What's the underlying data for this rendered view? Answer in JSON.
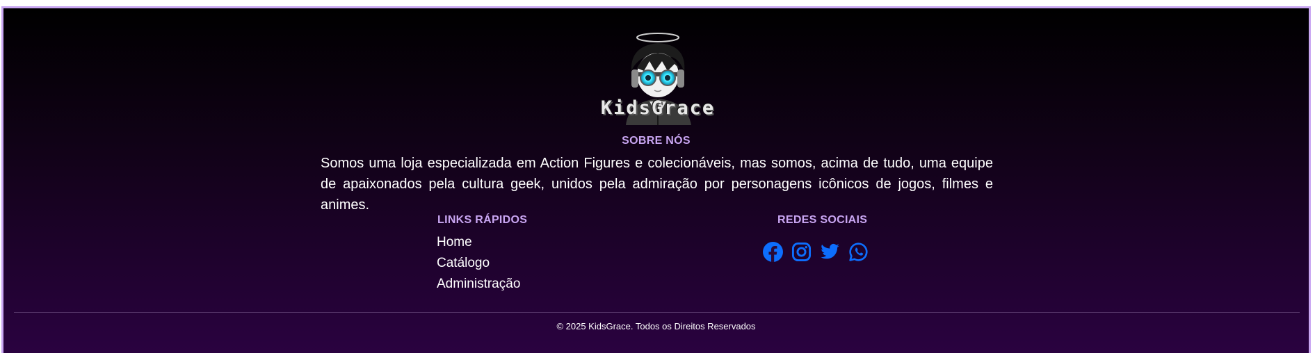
{
  "logo": {
    "text": "KidsGrace",
    "icon": "anime-character-goggles-logo"
  },
  "about": {
    "title": "SOBRE NÓS",
    "text": "Somos uma loja especializada em Action Figures e colecionáveis, mas somos, acima de tudo, uma equipe de apaixonados pela cultura geek, unidos pela admiração por personagens icônicos de jogos, filmes e animes."
  },
  "quick_links": {
    "title": "LINKS RÁPIDOS",
    "items": [
      {
        "label": "Home"
      },
      {
        "label": "Catálogo"
      },
      {
        "label": "Administração"
      }
    ]
  },
  "social": {
    "title": "REDES SOCIAIS",
    "icons": [
      "facebook-icon",
      "instagram-icon",
      "twitter-icon",
      "whatsapp-icon"
    ],
    "icon_color": "#0d6efd"
  },
  "footer": {
    "copyright": "© 2025 KidsGrace. Todos os Direitos Reservados"
  },
  "colors": {
    "accent": "#c9a6f2",
    "background_top": "#000000",
    "background_bottom": "#2a0240"
  }
}
